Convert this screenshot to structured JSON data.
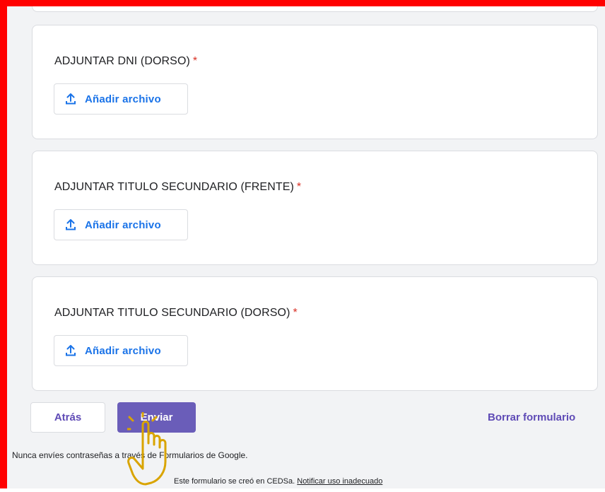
{
  "form": {
    "questions": [
      {
        "label": "ADJUNTAR DNI (DORSO)",
        "required_mark": "*",
        "upload_label": "Añadir archivo"
      },
      {
        "label": "ADJUNTAR TITULO SECUNDARIO (FRENTE)",
        "required_mark": "*",
        "upload_label": "Añadir archivo"
      },
      {
        "label": "ADJUNTAR TITULO SECUNDARIO (DORSO)",
        "required_mark": "*",
        "upload_label": "Añadir archivo"
      }
    ],
    "upload_icon": "upload-icon"
  },
  "actions": {
    "back_label": "Atrás",
    "submit_label": "Enviar",
    "clear_label": "Borrar formulario"
  },
  "notices": {
    "password_warning": "Nunca envíes contraseñas a través de Formularios de Google.",
    "created_in": "Este formulario se creó en CEDSa.",
    "report_link": "Notificar uso inadecuado"
  },
  "colors": {
    "accent": "#6a5db9",
    "link_blue": "#1a73e8",
    "required_red": "#d93025",
    "highlight_border": "#ff0000",
    "cursor_hand": "#d9a400"
  },
  "overlay": {
    "cursor_icon": "pointer-hand-cursor-icon"
  }
}
